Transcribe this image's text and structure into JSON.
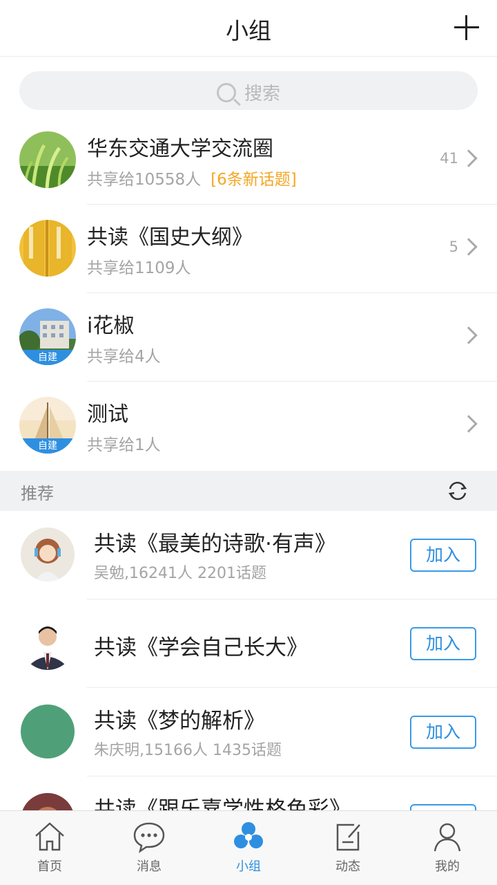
{
  "header": {
    "title": "小组"
  },
  "search": {
    "placeholder": "搜索"
  },
  "groups": [
    {
      "name": "华东交通大学交流圈",
      "shared": "共享给10558人",
      "new_topics": "[6条新话题]",
      "count": "41",
      "self_built": ""
    },
    {
      "name": "共读《国史大纲》",
      "shared": "共享给1109人",
      "new_topics": "",
      "count": "5",
      "self_built": ""
    },
    {
      "name": "i花椒",
      "shared": "共享给4人",
      "new_topics": "",
      "count": "",
      "self_built": "自建"
    },
    {
      "name": "测试",
      "shared": "共享给1人",
      "new_topics": "",
      "count": "",
      "self_built": "自建"
    }
  ],
  "recommend": {
    "title": "推荐",
    "items": [
      {
        "name": "共读《最美的诗歌·有声》",
        "meta": "吴勉,16241人 2201话题",
        "join": "加入"
      },
      {
        "name": "共读《学会自己长大》",
        "meta": "",
        "join": "加入"
      },
      {
        "name": "共读《梦的解析》",
        "meta": "朱庆明,15166人 1435话题",
        "join": "加入"
      },
      {
        "name": "共读《跟乐嘉学性格色彩》",
        "meta": "",
        "join": "加入"
      }
    ]
  },
  "tabs": [
    {
      "label": "首页",
      "icon": "home-icon"
    },
    {
      "label": "消息",
      "icon": "message-icon"
    },
    {
      "label": "小组",
      "icon": "group-icon"
    },
    {
      "label": "动态",
      "icon": "feed-icon"
    },
    {
      "label": "我的",
      "icon": "profile-icon"
    }
  ],
  "colors": {
    "accent": "#2e8fe0",
    "new_topics": "#f5a623",
    "join_border": "#3a9ae6"
  }
}
